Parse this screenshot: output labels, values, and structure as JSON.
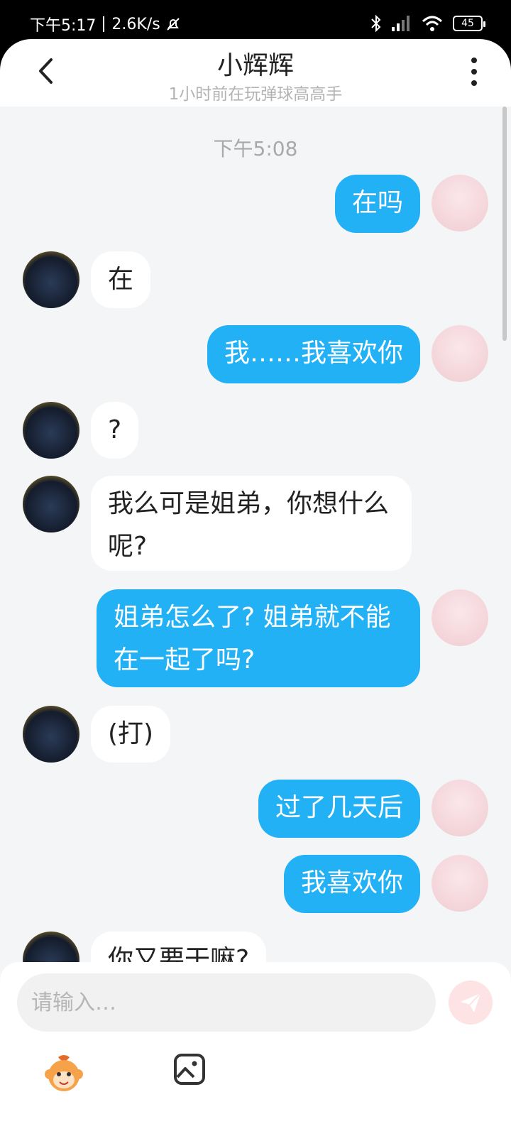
{
  "status_bar": {
    "time": "下午5:17",
    "net_speed": "2.6K/s",
    "battery": "45"
  },
  "header": {
    "title": "小辉辉",
    "subtitle": "1小时前在玩弹球高高手"
  },
  "chat": {
    "timestamp": "下午5:08",
    "messages": [
      {
        "from": "me",
        "text": "在吗"
      },
      {
        "from": "other",
        "text": "在"
      },
      {
        "from": "me",
        "text": "我……我喜欢你"
      },
      {
        "from": "other",
        "text": "?"
      },
      {
        "from": "other",
        "text": "我么可是姐弟，你想什么呢?"
      },
      {
        "from": "me",
        "text": "姐弟怎么了? 姐弟就不能在一起了吗?"
      },
      {
        "from": "other",
        "text": "(打)"
      },
      {
        "from": "me",
        "text": "过了几天后"
      },
      {
        "from": "me",
        "text": "我喜欢你"
      },
      {
        "from": "other",
        "text": "你又要干嘛?"
      }
    ]
  },
  "input": {
    "placeholder": "请输入…"
  },
  "colors": {
    "accent": "#23b1f5",
    "chat_bg": "#f4f5f7",
    "send_disabled": "#fde3e3"
  },
  "icons": {
    "back": "chevron-left-icon",
    "more": "more-vertical-icon",
    "send": "paper-plane-icon",
    "emoji": "monkey-emoji-icon",
    "image": "image-icon"
  }
}
